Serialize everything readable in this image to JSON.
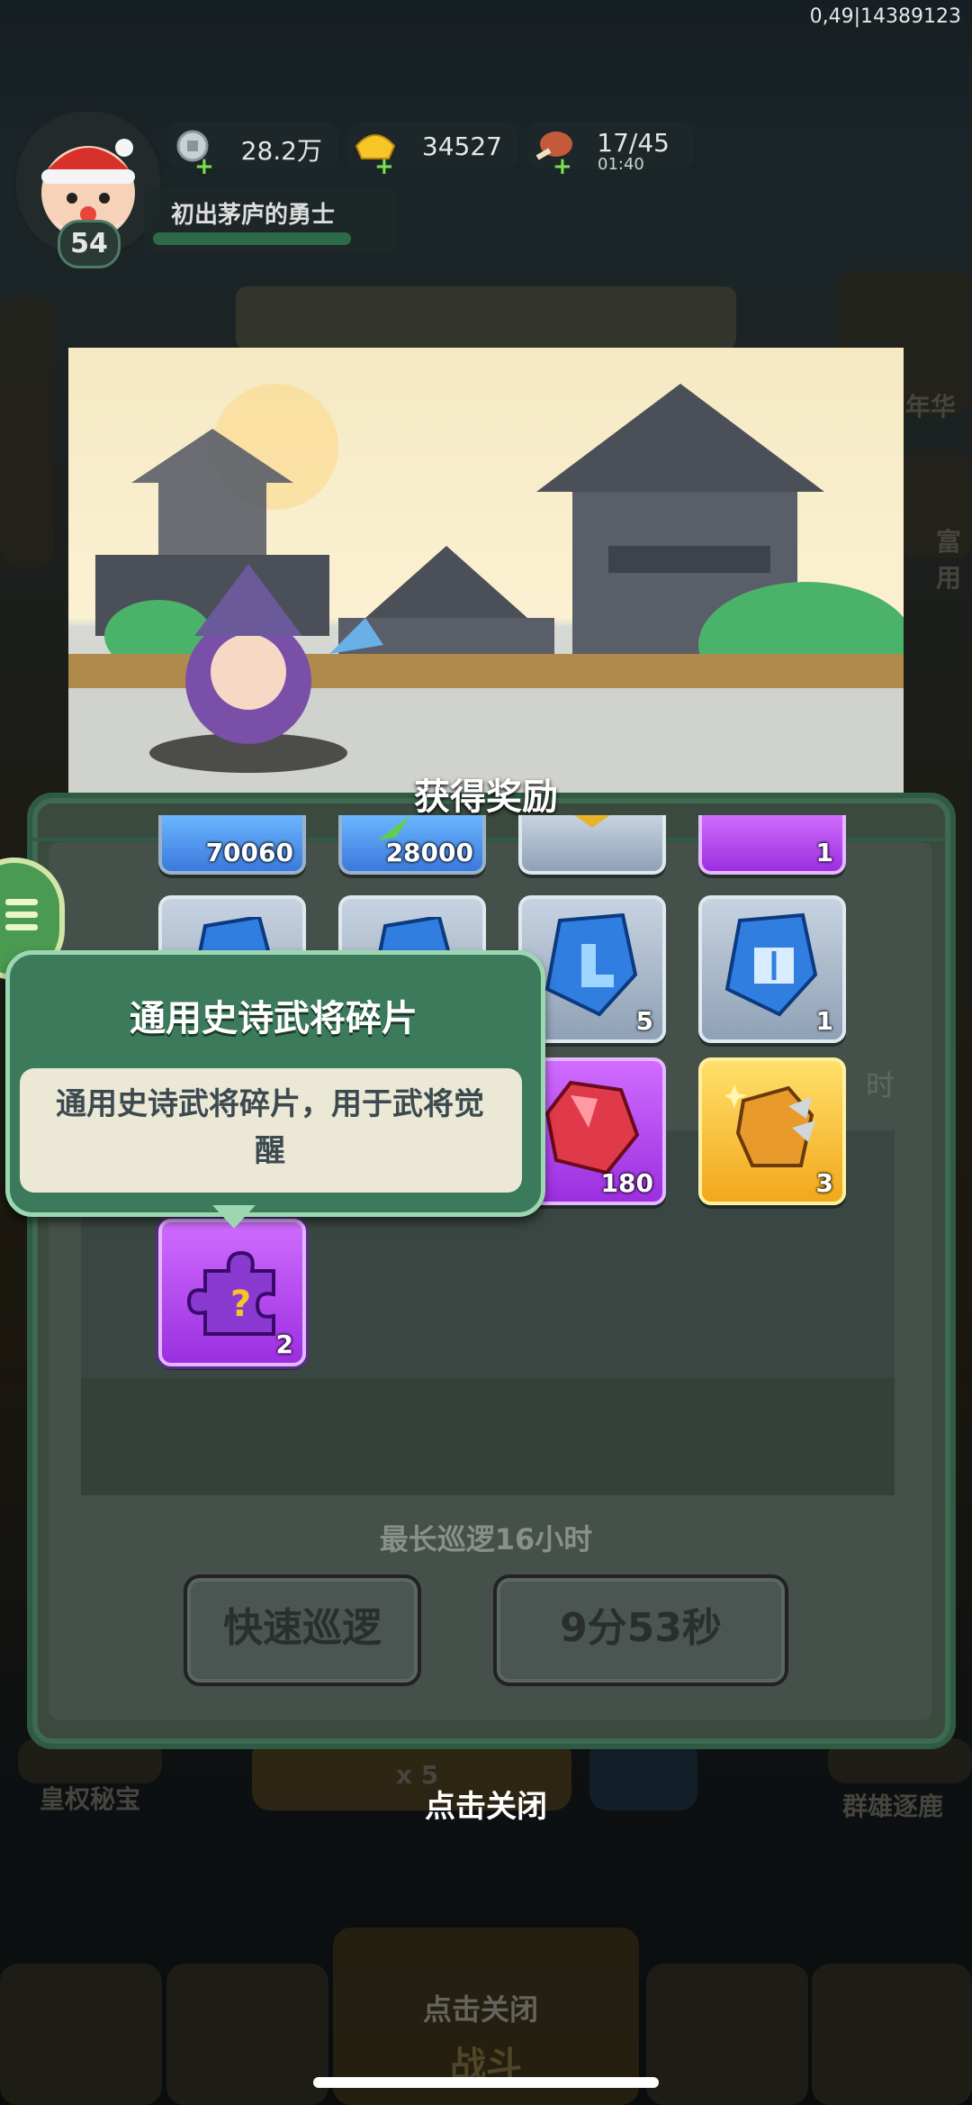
{
  "status": {
    "user_id": "0,49|14389123"
  },
  "player": {
    "level": "54",
    "title": "初出茅庐的勇士"
  },
  "resources": [
    {
      "icon": "silver-coin-icon",
      "value": "28.2万"
    },
    {
      "icon": "gold-ingot-icon",
      "value": "34527"
    },
    {
      "icon": "meat-stamina-icon",
      "value": "17/45",
      "timer": "01:40"
    }
  ],
  "background": {
    "left_label": "皇权秘宝",
    "right_label": "群雄逐鹿",
    "bottom_center_hint": "点击关闭",
    "bottom_center_button": "战斗",
    "multiplier": "x 5",
    "right_tag_1": "年华",
    "right_tag_2": "富用"
  },
  "reward": {
    "title": "获得奖励",
    "items": [
      {
        "color": "blue",
        "icon": "silver-coin-icon",
        "count": "70060"
      },
      {
        "color": "blue",
        "icon": "green-feather-icon",
        "count": "28000"
      },
      {
        "color": "gray",
        "icon": "gold-item-icon",
        "count": ""
      },
      {
        "color": "purple",
        "icon": "scroll-icon",
        "count": "1"
      },
      {
        "color": "gray",
        "icon": "blue-crystal-icon",
        "count": ""
      },
      {
        "color": "gray",
        "icon": "blue-crystal-icon",
        "count": ""
      },
      {
        "color": "gray",
        "icon": "blue-boot-crystal-icon",
        "count": "5"
      },
      {
        "color": "gray",
        "icon": "blue-sword-crystal-icon",
        "count": "1"
      },
      {
        "color": "purple",
        "icon": "red-gem-icon",
        "count": "180"
      },
      {
        "color": "gold",
        "icon": "golden-armor-piece-icon",
        "count": "3"
      },
      {
        "color": "purple",
        "icon": "purple-puzzle-piece-icon",
        "count": "2"
      }
    ]
  },
  "tooltip": {
    "title": "通用史诗武将碎片",
    "description": "通用史诗武将碎片，用于武将觉醒"
  },
  "patrol": {
    "max_text": "最长巡逻16小时",
    "quick_button": "快速巡逻",
    "timer_button": "9分53秒",
    "side_char": "时"
  },
  "close_hint": "点击关闭"
}
